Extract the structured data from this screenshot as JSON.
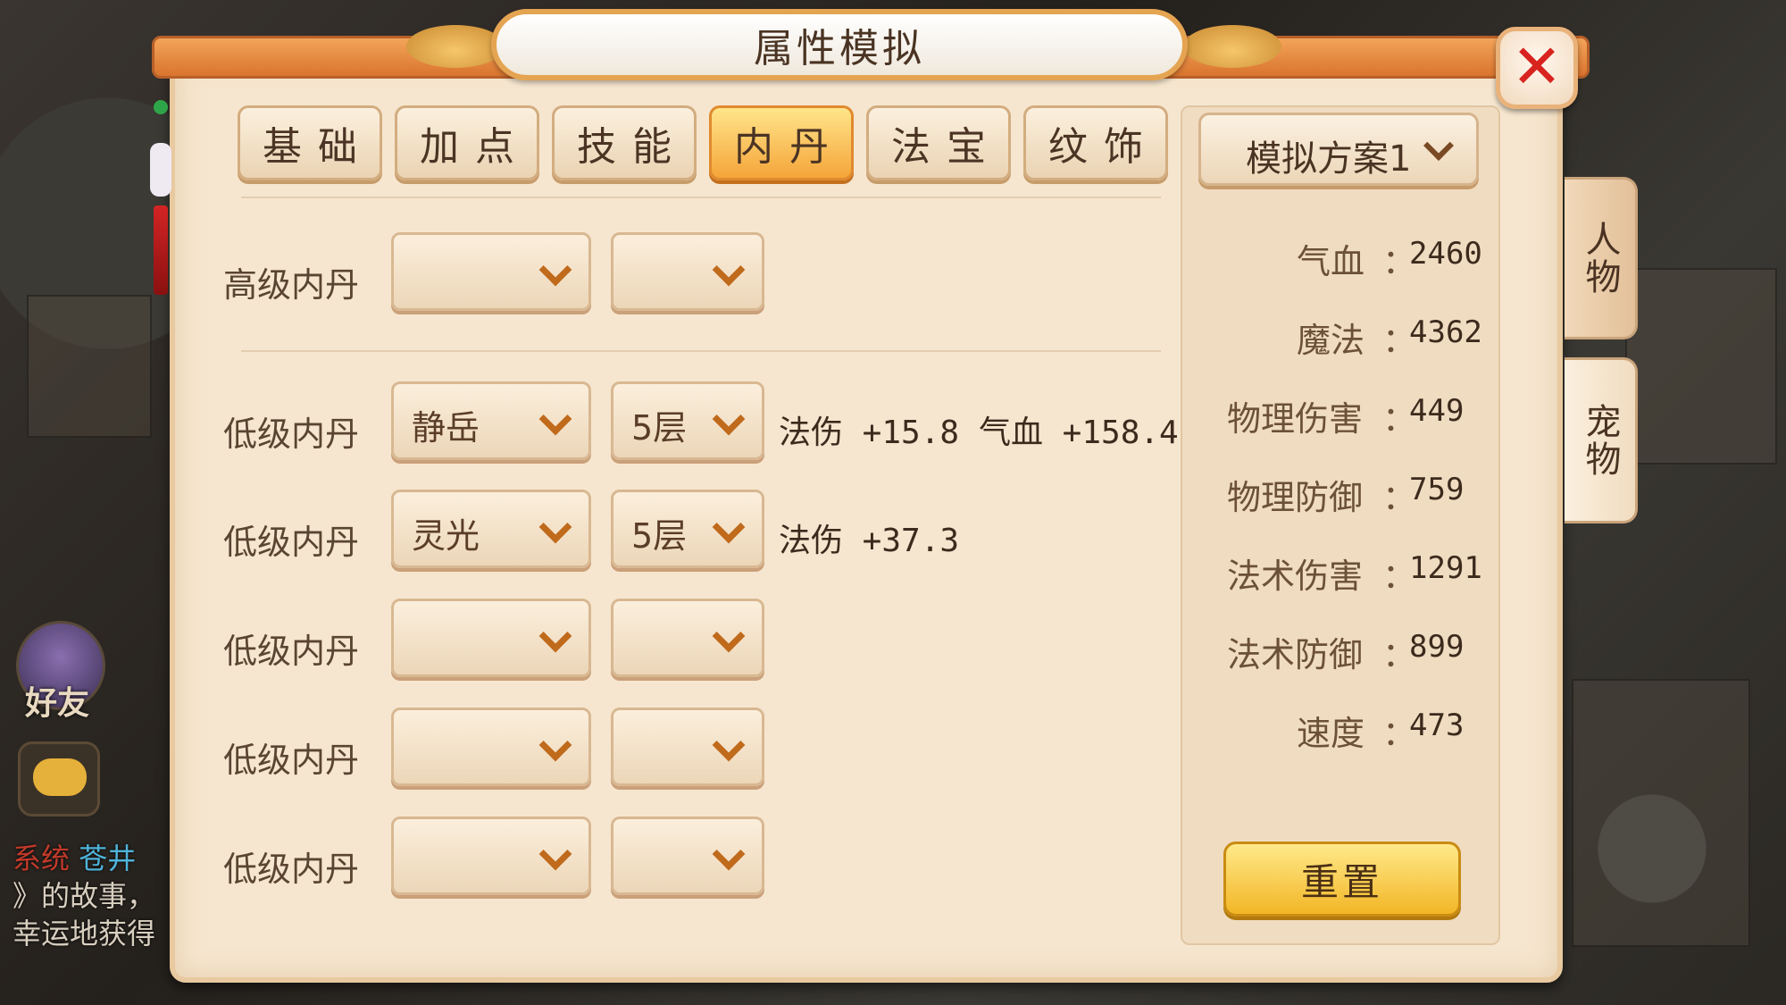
{
  "window": {
    "title": "属性模拟",
    "close_icon": "close-icon"
  },
  "tabs": [
    {
      "label": "基础",
      "active": false
    },
    {
      "label": "加点",
      "active": false
    },
    {
      "label": "技能",
      "active": false
    },
    {
      "label": "内丹",
      "active": true
    },
    {
      "label": "法宝",
      "active": false
    },
    {
      "label": "纹饰",
      "active": false
    }
  ],
  "neidan": {
    "rows": [
      {
        "label": "高级内丹",
        "select1": "",
        "select2": "",
        "effects": []
      },
      {
        "label": "低级内丹",
        "select1": "静岳",
        "select2": "5层",
        "effects": [
          "法伤 +15.8",
          "气血 +158.4"
        ]
      },
      {
        "label": "低级内丹",
        "select1": "灵光",
        "select2": "5层",
        "effects": [
          "法伤 +37.3"
        ]
      },
      {
        "label": "低级内丹",
        "select1": "",
        "select2": "",
        "effects": []
      },
      {
        "label": "低级内丹",
        "select1": "",
        "select2": "",
        "effects": []
      },
      {
        "label": "低级内丹",
        "select1": "",
        "select2": "",
        "effects": []
      }
    ]
  },
  "plan": {
    "selected": "模拟方案1"
  },
  "stats": [
    {
      "label": "气血",
      "value": "2460"
    },
    {
      "label": "魔法",
      "value": "4362"
    },
    {
      "label": "物理伤害",
      "value": "449"
    },
    {
      "label": "物理防御",
      "value": "759"
    },
    {
      "label": "法术伤害",
      "value": "1291"
    },
    {
      "label": "法术防御",
      "value": "899"
    },
    {
      "label": "速度",
      "value": "473"
    }
  ],
  "stat_separator": "：",
  "reset_label": "重置",
  "side_tabs": [
    {
      "label": "人物",
      "active": false
    },
    {
      "label": "宠物",
      "active": true
    }
  ],
  "background": {
    "friend_label": "好友",
    "chat_lines": [
      {
        "sys": "系统",
        "name": "苍井",
        "text": ""
      },
      {
        "text": "》的故事，"
      },
      {
        "text": "幸运地获得"
      }
    ]
  },
  "colors": {
    "active_tab": "#f5a53a",
    "reset_button": "#f2b626",
    "close_x": "#d8231f"
  }
}
